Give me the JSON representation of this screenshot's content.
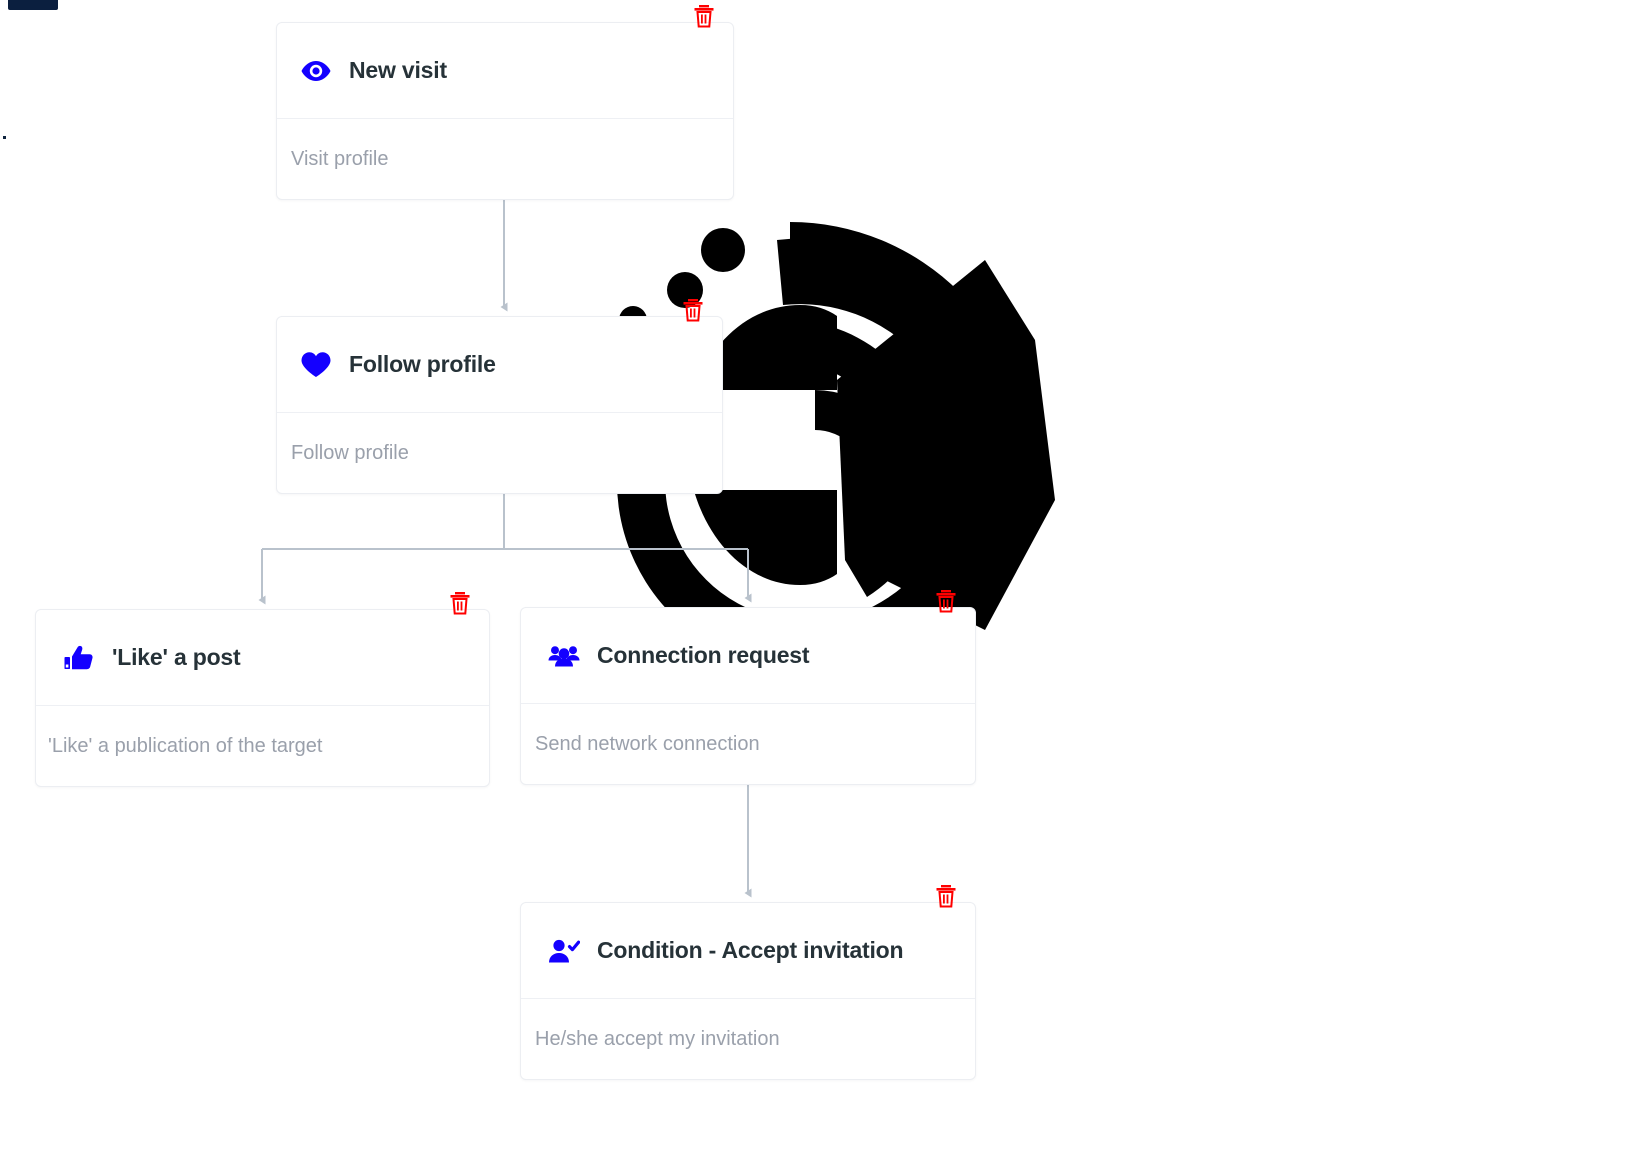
{
  "brand": {
    "chip_name": "app-logo-chip",
    "color": "#0b1f3f"
  },
  "watermark": {
    "name": "swirl-logo-watermark",
    "color": "#000000"
  },
  "theme": {
    "accent_blue": "#1400ff",
    "delete_red": "#ff0000",
    "title_color": "#263238",
    "desc_color": "#9aa0ab",
    "connector_color": "#b9c2cc",
    "card_border": "#eceef2",
    "background": "#ffffff"
  },
  "workflow": {
    "delete_label": "trash-icon",
    "nodes": [
      {
        "id": "new-visit",
        "icon": "eye-icon",
        "title": "New visit",
        "description": "Visit profile"
      },
      {
        "id": "follow-profile",
        "icon": "heart-icon",
        "title": "Follow profile",
        "description": "Follow profile"
      },
      {
        "id": "like-post",
        "icon": "thumbs-up-icon",
        "title": "'Like' a post",
        "description": "'Like' a publication of the target"
      },
      {
        "id": "connection-request",
        "icon": "people-group-icon",
        "title": "Connection request",
        "description": "Send network connection"
      },
      {
        "id": "condition-accept",
        "icon": "person-check-icon",
        "title": "Condition - Accept invitation",
        "description": "He/she accept my invitation"
      }
    ],
    "edges": [
      {
        "from": "new-visit",
        "to": "follow-profile"
      },
      {
        "from": "follow-profile",
        "to": "like-post"
      },
      {
        "from": "follow-profile",
        "to": "connection-request"
      },
      {
        "from": "connection-request",
        "to": "condition-accept"
      }
    ]
  }
}
